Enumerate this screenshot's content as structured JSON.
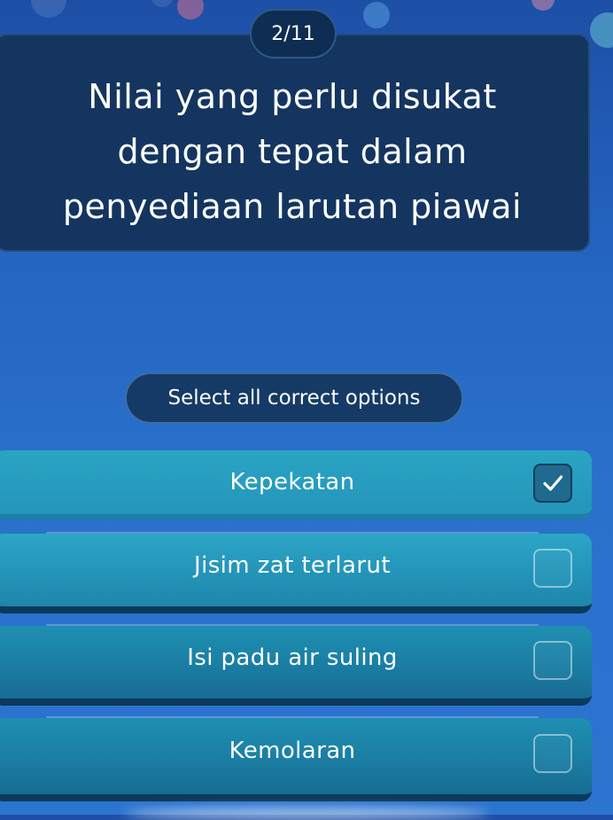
{
  "counter": "2/11",
  "question": {
    "text": "Nilai yang perlu disukat dengan tepat dalam penyediaan larutan piawai"
  },
  "instruction": "Select all correct options",
  "options": [
    {
      "label": "Kepekatan",
      "checked": true
    },
    {
      "label": "Jisim zat terlarut",
      "checked": false
    },
    {
      "label": "Isi padu air suling",
      "checked": false
    },
    {
      "label": "Kemolaran",
      "checked": false
    }
  ],
  "colors": {
    "background": "#2464c0",
    "card": "#14355f",
    "option": "#2394b8",
    "option_edge": "#0b3a5a"
  },
  "icons": {
    "checked_box": "checkmark-icon"
  }
}
